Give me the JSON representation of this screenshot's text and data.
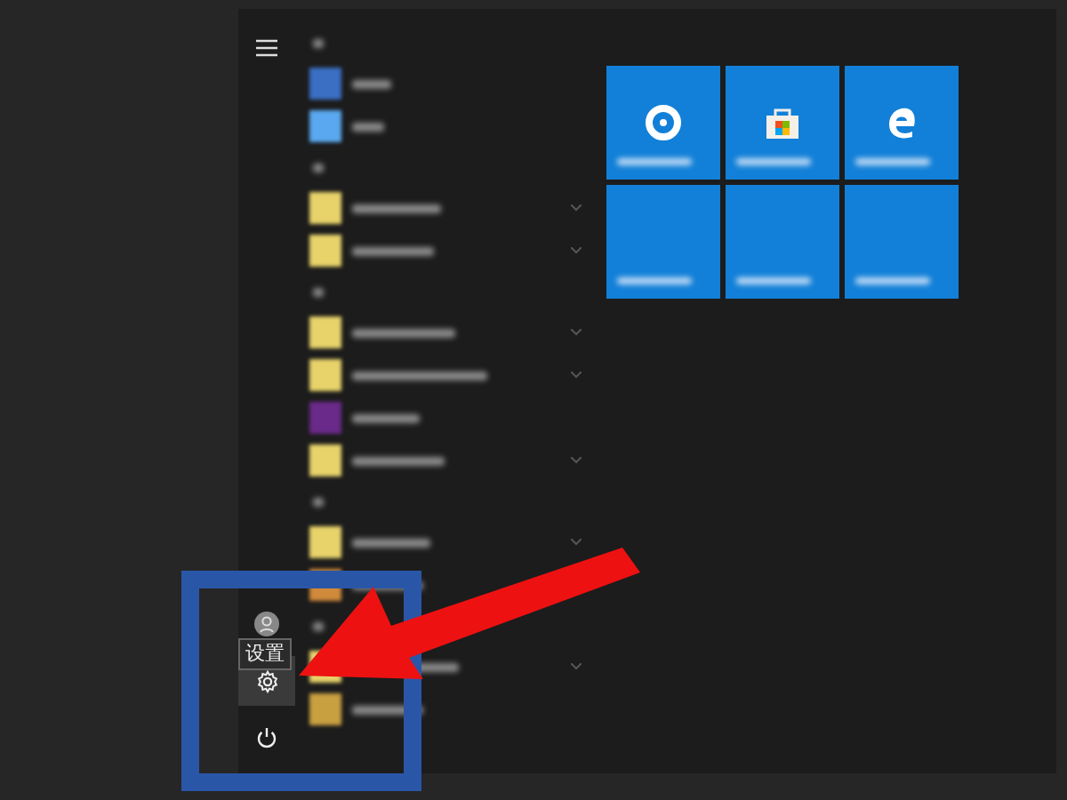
{
  "sidebar": {
    "tooltip": "设置",
    "items": [
      {
        "kind": "menu",
        "selected": false
      },
      {
        "kind": "user",
        "selected": false
      },
      {
        "kind": "settings",
        "selected": true
      },
      {
        "kind": "power",
        "selected": false
      }
    ]
  },
  "app_list": [
    {
      "kind": "header"
    },
    {
      "kind": "app",
      "color": "#3a6fc4",
      "expandable": false
    },
    {
      "kind": "app",
      "color": "#5aa8f0",
      "expandable": false
    },
    {
      "kind": "header"
    },
    {
      "kind": "app",
      "color": "#e8d36a",
      "expandable": true
    },
    {
      "kind": "app",
      "color": "#e8d36a",
      "expandable": true
    },
    {
      "kind": "header"
    },
    {
      "kind": "app",
      "color": "#e8d36a",
      "expandable": true
    },
    {
      "kind": "app",
      "color": "#e8d36a",
      "expandable": true
    },
    {
      "kind": "app",
      "color": "#6a2a8a",
      "expandable": false
    },
    {
      "kind": "app",
      "color": "#e8d36a",
      "expandable": true
    },
    {
      "kind": "header"
    },
    {
      "kind": "app",
      "color": "#e8d36a",
      "expandable": true
    },
    {
      "kind": "app",
      "color": "#d08a3a"
    },
    {
      "kind": "header"
    },
    {
      "kind": "app",
      "color": "#e8d36a",
      "expandable": true
    },
    {
      "kind": "app",
      "color": "#c9a040",
      "expandable": false
    }
  ],
  "tiles": [
    {
      "kind": "gear"
    },
    {
      "kind": "store"
    },
    {
      "kind": "edge"
    },
    {
      "kind": "blank"
    },
    {
      "kind": "blank"
    },
    {
      "kind": "blank"
    }
  ]
}
